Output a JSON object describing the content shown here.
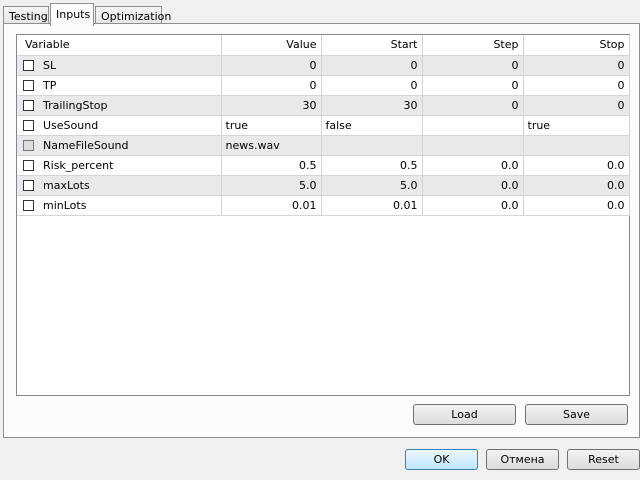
{
  "tabs": [
    {
      "label": "Testing"
    },
    {
      "label": "Inputs"
    },
    {
      "label": "Optimization"
    }
  ],
  "columns": [
    "Variable",
    "Value",
    "Start",
    "Step",
    "Stop"
  ],
  "rows": [
    {
      "name": "SL",
      "value": "0",
      "start": "0",
      "step": "0",
      "stop": "0",
      "align": "r",
      "enabled": true
    },
    {
      "name": "TP",
      "value": "0",
      "start": "0",
      "step": "0",
      "stop": "0",
      "align": "r",
      "enabled": true
    },
    {
      "name": "TrailingStop",
      "value": "30",
      "start": "30",
      "step": "0",
      "stop": "0",
      "align": "r",
      "enabled": true
    },
    {
      "name": "UseSound",
      "value": "true",
      "start": "false",
      "step": "",
      "stop": "true",
      "align": "l",
      "enabled": true
    },
    {
      "name": "NameFileSound",
      "value": "news.wav",
      "start": "",
      "step": "",
      "stop": "",
      "align": "l",
      "enabled": false
    },
    {
      "name": "Risk_percent",
      "value": "0.5",
      "start": "0.5",
      "step": "0.0",
      "stop": "0.0",
      "align": "r",
      "enabled": true
    },
    {
      "name": "maxLots",
      "value": "5.0",
      "start": "5.0",
      "step": "0.0",
      "stop": "0.0",
      "align": "r",
      "enabled": true
    },
    {
      "name": "minLots",
      "value": "0.01",
      "start": "0.01",
      "step": "0.0",
      "stop": "0.0",
      "align": "r",
      "enabled": true
    }
  ],
  "buttons": {
    "load": "Load",
    "save": "Save",
    "ok": "OK",
    "cancel": "Отмена",
    "reset": "Reset"
  }
}
